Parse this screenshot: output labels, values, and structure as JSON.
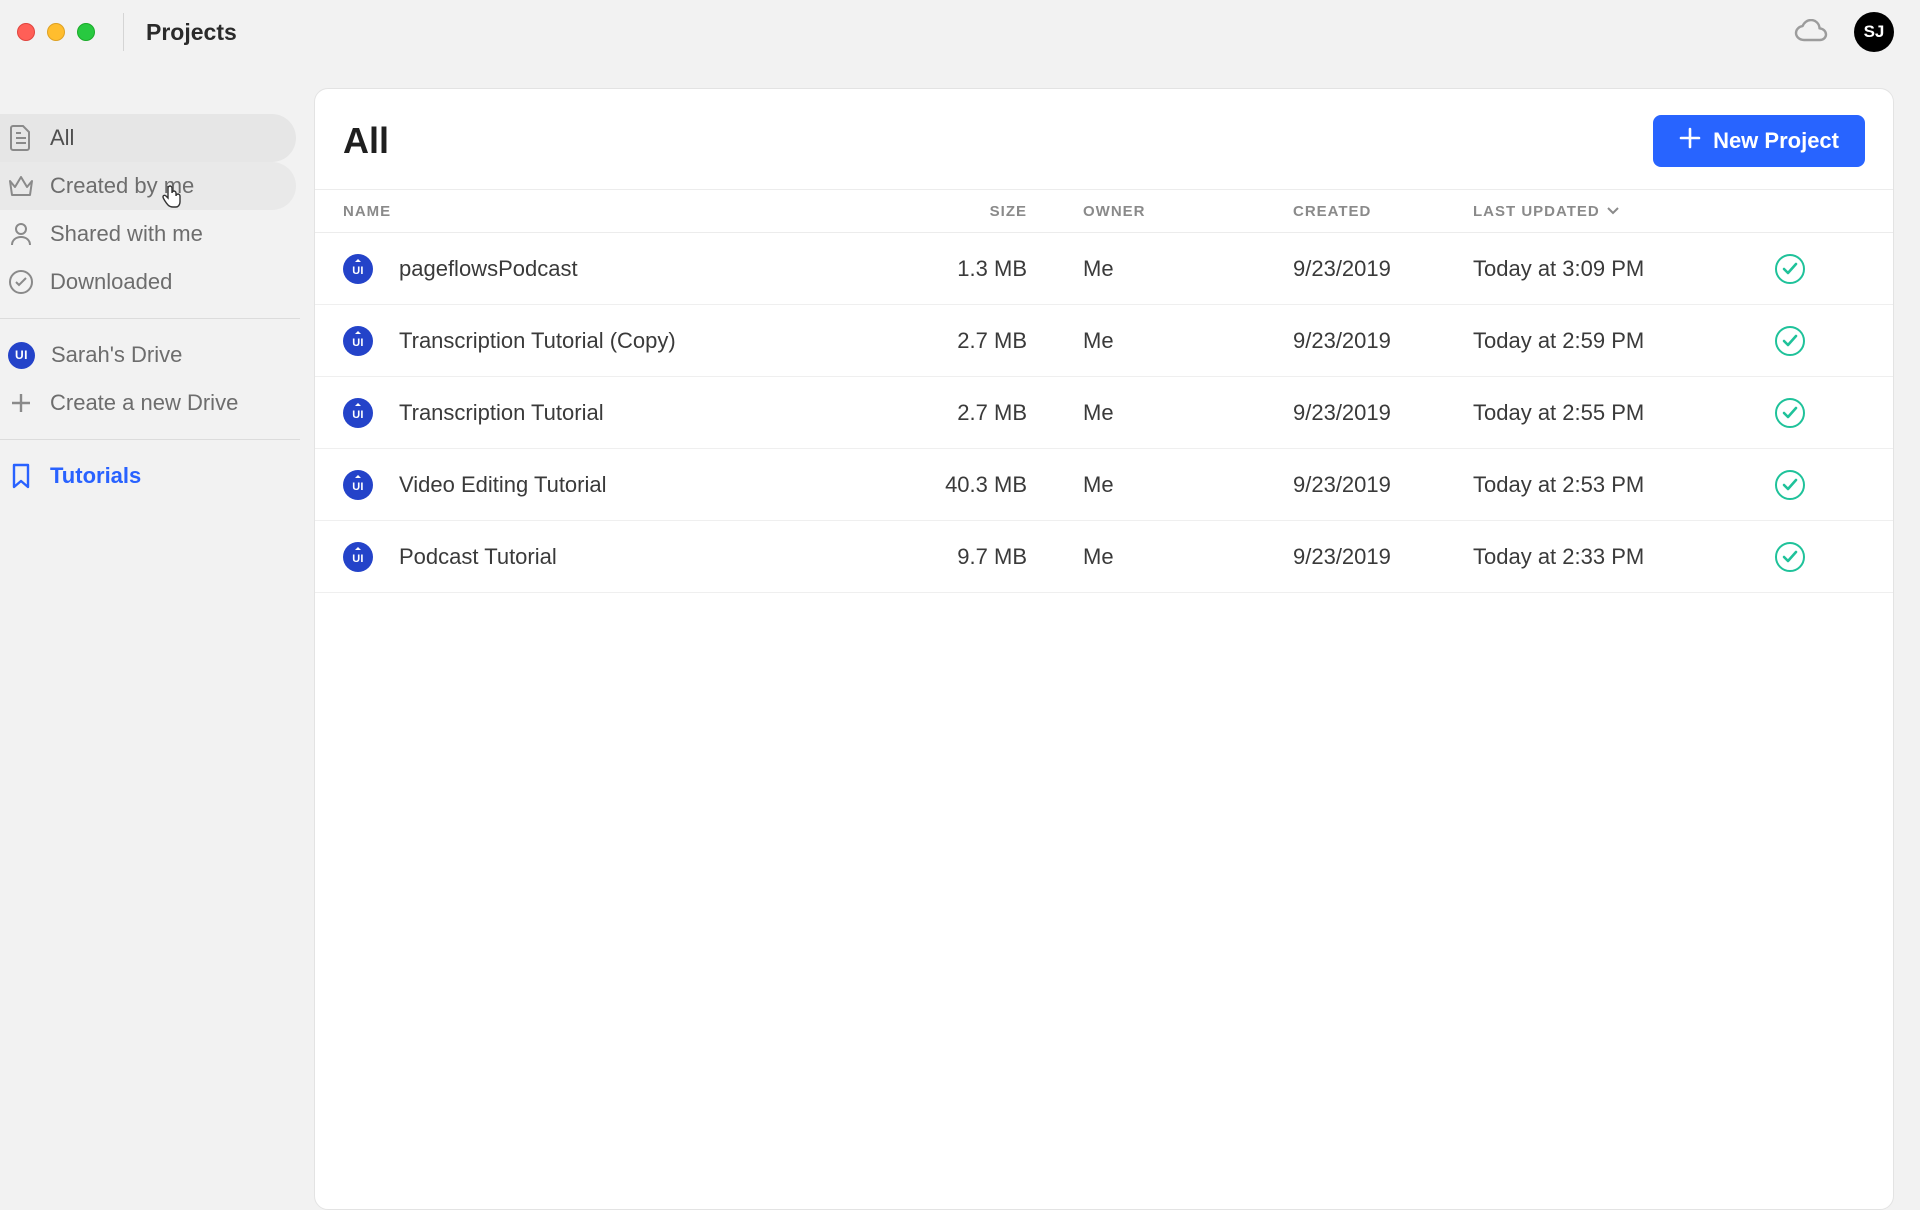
{
  "titlebar": {
    "title": "Projects",
    "avatar_initials": "SJ"
  },
  "sidebar": {
    "filters": [
      {
        "id": "all",
        "label": "All",
        "icon": "doc"
      },
      {
        "id": "created",
        "label": "Created by me",
        "icon": "crown"
      },
      {
        "id": "shared",
        "label": "Shared with me",
        "icon": "person"
      },
      {
        "id": "downloaded",
        "label": "Downloaded",
        "icon": "check"
      }
    ],
    "drive": {
      "label": "Sarah's Drive",
      "badge": "UI"
    },
    "create_drive_label": "Create a new Drive",
    "tutorials_label": "Tutorials"
  },
  "main": {
    "title": "All",
    "new_project_label": "New Project",
    "columns": {
      "name": "NAME",
      "size": "SIZE",
      "owner": "OWNER",
      "created": "CREATED",
      "updated": "LAST UPDATED"
    },
    "rows": [
      {
        "name": "pageflowsPodcast",
        "size": "1.3 MB",
        "owner": "Me",
        "created": "9/23/2019",
        "updated": "Today at 3:09 PM"
      },
      {
        "name": "Transcription Tutorial (Copy)",
        "size": "2.7 MB",
        "owner": "Me",
        "created": "9/23/2019",
        "updated": "Today at 2:59 PM"
      },
      {
        "name": "Transcription Tutorial",
        "size": "2.7 MB",
        "owner": "Me",
        "created": "9/23/2019",
        "updated": "Today at 2:55 PM"
      },
      {
        "name": "Video Editing Tutorial",
        "size": "40.3 MB",
        "owner": "Me",
        "created": "9/23/2019",
        "updated": "Today at 2:53 PM"
      },
      {
        "name": "Podcast Tutorial",
        "size": "9.7 MB",
        "owner": "Me",
        "created": "9/23/2019",
        "updated": "Today at 2:33 PM"
      }
    ]
  }
}
